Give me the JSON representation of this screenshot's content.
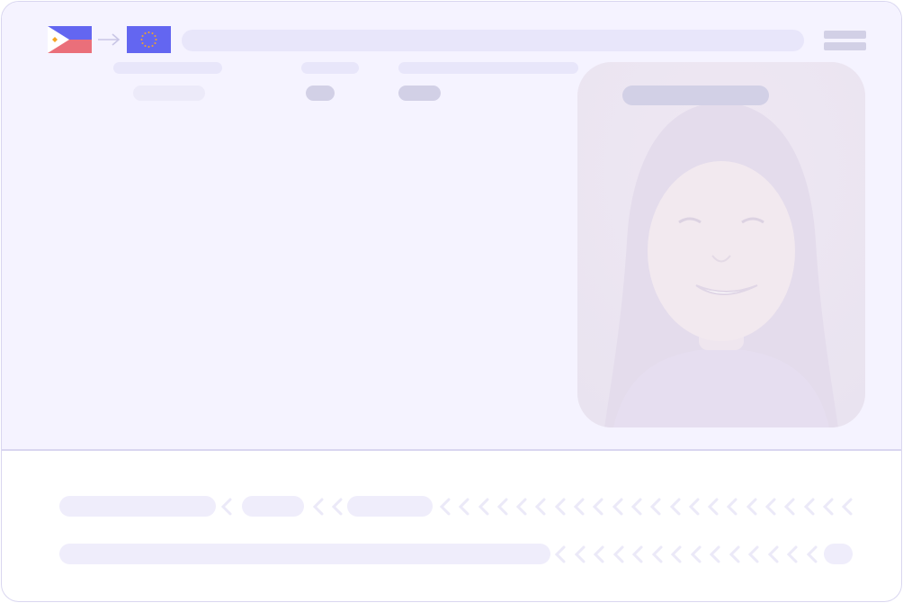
{
  "document": {
    "type": "id-card-template",
    "issuer_flag": "philippines-flag",
    "target_flag": "european-union-flag",
    "arrow": "arrow-right-icon",
    "menu": "menu-icon"
  },
  "colors": {
    "card_bg": "#f5f3ff",
    "placeholder_light": "#e8e6fa",
    "placeholder_dark": "#d2d0e6",
    "border": "#d9d6f0",
    "flag_blue": "#6366f1",
    "flag_red": "#ea6f7a",
    "flag_gold": "#f5a623"
  },
  "mrz": {
    "line_count": 2,
    "filler_char": "<"
  }
}
